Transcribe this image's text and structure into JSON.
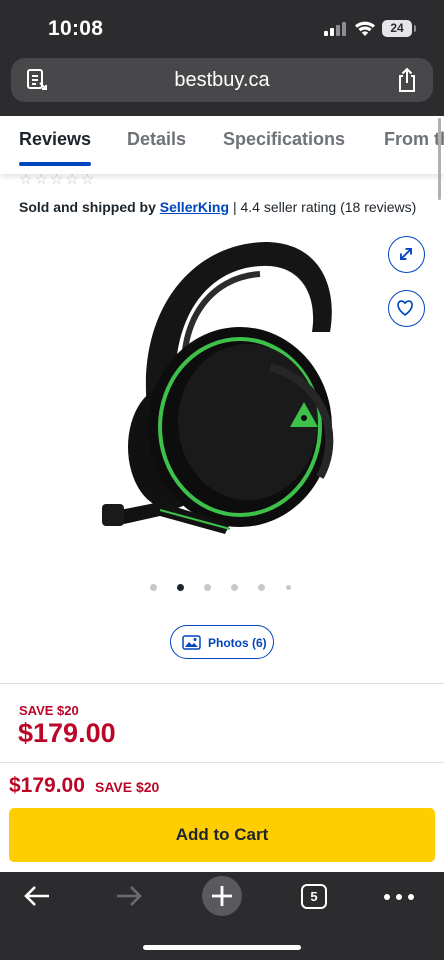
{
  "status_bar": {
    "time": "10:08",
    "battery": "24"
  },
  "browser": {
    "url": "bestbuy.ca",
    "open_tabs": "5"
  },
  "tabs": [
    {
      "label": "Reviews",
      "active": true
    },
    {
      "label": "Details",
      "active": false
    },
    {
      "label": "Specifications",
      "active": false
    },
    {
      "label": "From the Manufacturer",
      "active": false
    }
  ],
  "seller": {
    "prefix": "Sold and shipped by",
    "name": "SellerKing",
    "rating": "| 4.4 seller rating (18 reviews)"
  },
  "gallery": {
    "dot_count": 6,
    "active_index": 1,
    "photos_label": "Photos (6)"
  },
  "pricing": {
    "save_label": "SAVE $20",
    "price": "$179.00",
    "sticky_price": "$179.00",
    "sticky_save": "SAVE $20"
  },
  "actions": {
    "add_to_cart": "Add to Cart"
  },
  "colors": {
    "brand_blue": "#0046be",
    "sale_red": "#bb0628",
    "cta_yellow": "#ffce00",
    "accent_green": "#3ec14a"
  },
  "icons": [
    "reader-icon",
    "share-icon",
    "expand-icon",
    "heart-icon",
    "photos-icon",
    "back-arrow-icon",
    "forward-arrow-icon",
    "plus-icon",
    "tabs-icon",
    "more-icon"
  ]
}
